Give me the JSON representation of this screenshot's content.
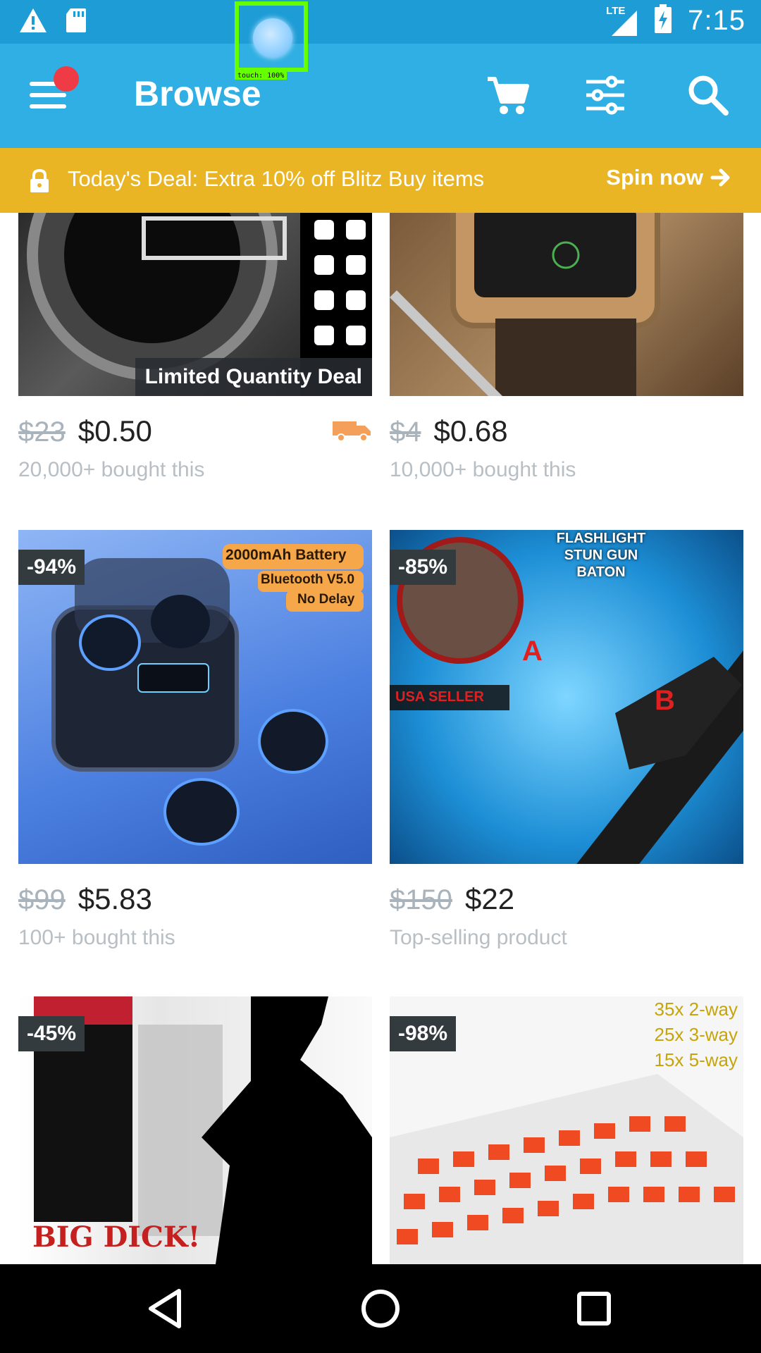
{
  "status_bar": {
    "time": "7:15",
    "network": "LTE"
  },
  "touch_indicator": {
    "label": "touch: 100%"
  },
  "app_bar": {
    "title": "Browse"
  },
  "deal_banner": {
    "text": "Today's Deal: Extra 10% off Blitz Buy items",
    "action": "Spin now"
  },
  "products": [
    {
      "old_price": "$23",
      "price": "$0.50",
      "subtext": "20,000+ bought this",
      "ribbon": "Limited Quantity Deal",
      "badge": ""
    },
    {
      "old_price": "$4",
      "price": "$0.68",
      "subtext": "10,000+ bought this",
      "ribbon": "",
      "badge": ""
    },
    {
      "old_price": "$99",
      "price": "$5.83",
      "subtext": "100+ bought this",
      "badge": "-94%",
      "image_text": [
        "2000mAh Battery",
        "Bluetooth V5.0",
        "No Delay"
      ]
    },
    {
      "old_price": "$150",
      "price": "$22",
      "subtext": "Top-selling product",
      "badge": "-85%",
      "image_text": [
        "FLASHLIGHT",
        "STUN GUN",
        "BATON",
        "USA SELLER",
        "A",
        "B"
      ]
    },
    {
      "badge": "-45%",
      "image_text": [
        "BIG DICK!"
      ]
    },
    {
      "badge": "-98%",
      "image_text": [
        "35x 2-way",
        "25x 3-way",
        "15x 5-way"
      ]
    }
  ],
  "colors": {
    "status_bar": "#1e9cd6",
    "app_bar": "#2fafe3",
    "banner": "#e9b524",
    "notification_dot": "#ee3b45"
  }
}
